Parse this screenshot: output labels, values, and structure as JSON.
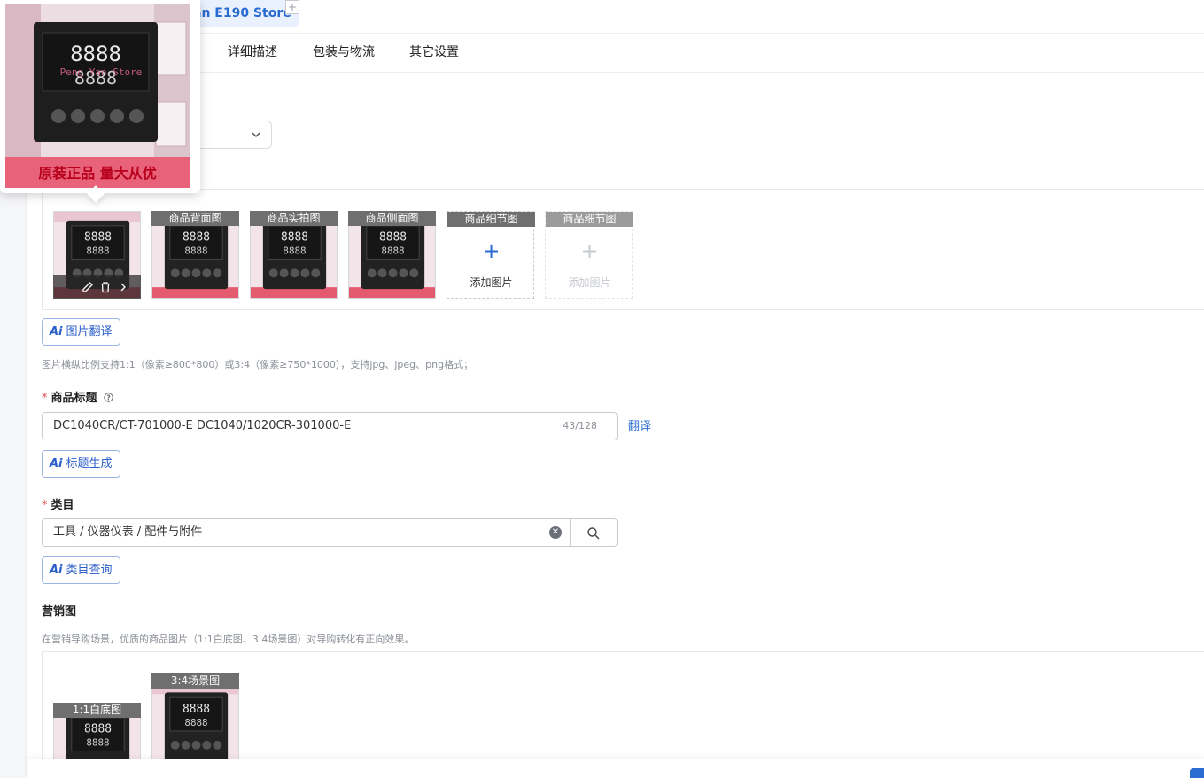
{
  "store_tab": {
    "label": "an E190 Store",
    "add_symbol": "+"
  },
  "nav_tabs": [
    "详细描述",
    "包装与物流",
    "其它设置"
  ],
  "popup_preview": {
    "badge_text": "原装正品 量大从优",
    "watermark": "Peng Yan Store"
  },
  "product_images": {
    "slots": [
      {
        "label": "",
        "filled": true
      },
      {
        "label": "商品背面图",
        "filled": true
      },
      {
        "label": "商品实拍图",
        "filled": true
      },
      {
        "label": "商品侧面图",
        "filled": true
      },
      {
        "label": "商品细节图",
        "filled": false,
        "add_text": "添加图片"
      },
      {
        "label": "商品细节图",
        "filled": false,
        "add_text": "添加图片",
        "disabled": true
      }
    ]
  },
  "ai_translate_btn": "图片翻译",
  "ai_mark": "Ai",
  "image_hint": "图片横纵比例支持1:1（像素≥800*800）或3:4（像素≥750*1000），支持jpg、jpeg、png格式；",
  "title_field": {
    "required_mark": "*",
    "label": "商品标题",
    "value": "DC1040CR/CT-701000-E DC1040/1020CR-301000-E",
    "count": "43/128",
    "translate": "翻译"
  },
  "ai_title_btn": "标题生成",
  "category_field": {
    "required_mark": "*",
    "label": "类目",
    "value": "工具 / 仪器仪表 / 配件与附件"
  },
  "ai_category_btn": "类目查询",
  "marketing": {
    "label": "营销图",
    "hint": "在营销导购场景，优质的商品图片（1:1白底图、3:4场景图）对导购转化有正向效果。",
    "slots": [
      {
        "label": "1:1白底图"
      },
      {
        "label": "3:4场景图"
      }
    ]
  }
}
